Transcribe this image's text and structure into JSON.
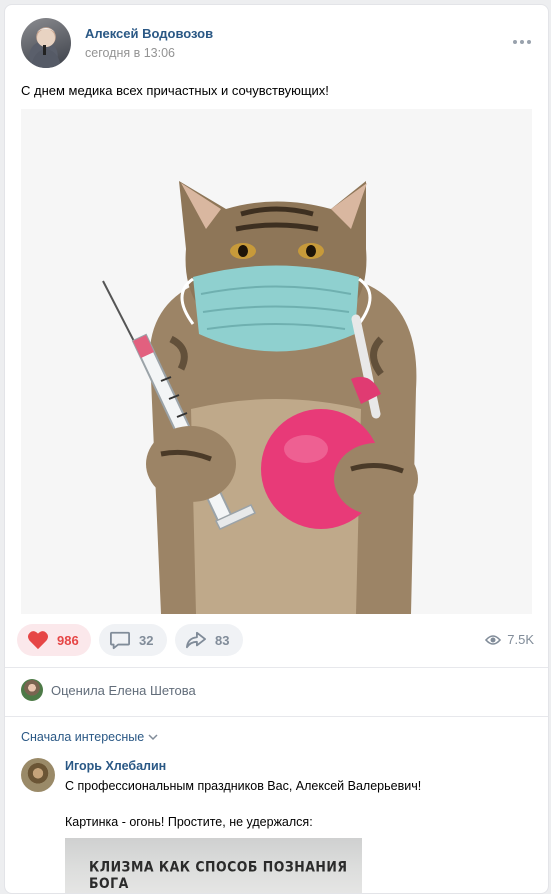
{
  "post": {
    "author": "Алексей Водовозов",
    "time": "сегодня в 13:06",
    "text": "С днем медика всех причастных и сочувствующих!"
  },
  "actions": {
    "likes": "986",
    "comments": "32",
    "shares": "83",
    "views": "7.5K"
  },
  "rated": {
    "text": "Оценила Елена Шетова"
  },
  "comments_section": {
    "sort_label": "Сначала интересные"
  },
  "comment": {
    "author": "Игорь Хлебалин",
    "line1": "С профессиональным праздников Вас, Алексей Валерьевич!",
    "line2": "Картинка - огонь! Простите, не удержался:",
    "image_text": "КЛИЗМА КАК СПОСОБ ПОЗНАНИЯ БОГА"
  },
  "colors": {
    "link": "#2a5885",
    "like_active": "#e64646",
    "muted": "#818c99"
  }
}
